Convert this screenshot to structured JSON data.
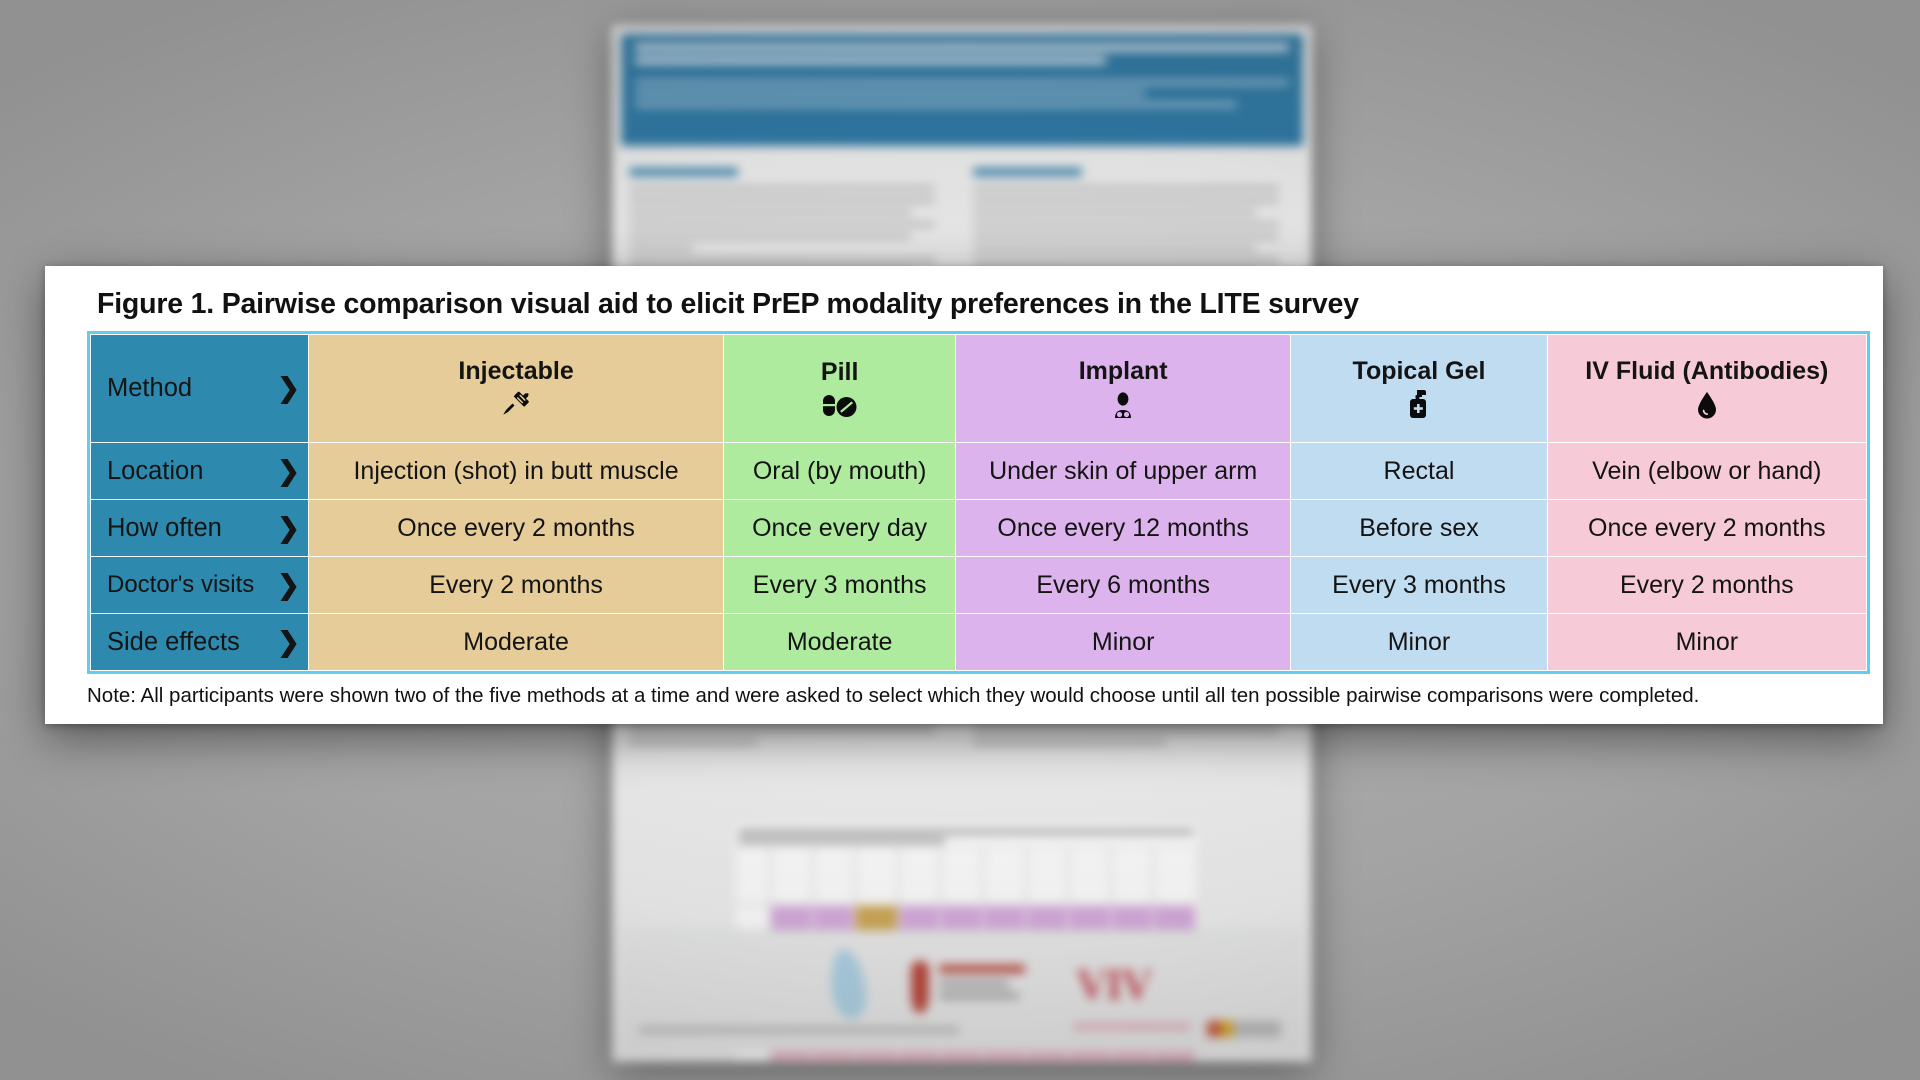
{
  "figure": {
    "title": "Figure 1. Pairwise comparison visual aid to elicit PrEP modality preferences in the LITE survey",
    "note": "Note: All participants were shown two of the five methods at a time and were asked to select which they would choose until all ten possible pairwise comparisons were completed."
  },
  "colors": {
    "label_column": "#2d89ae",
    "table_frame": "#63cdf0",
    "injectable": "#e5cc99",
    "pill": "#aeeb9e",
    "implant": "#dcb3ec",
    "topical_gel": "#bfdcf1",
    "iv_fluid": "#f7cad8",
    "card_background": "#ffffff",
    "page_background": "#a9a9a9"
  },
  "table": {
    "corner_label": "Method",
    "corner_chevron": "❯",
    "columns": [
      {
        "key": "injectable",
        "label": "Injectable",
        "icon": "syringe-icon"
      },
      {
        "key": "pill",
        "label": "Pill",
        "icon": "pills-icon"
      },
      {
        "key": "implant",
        "label": "Implant",
        "icon": "implant-arm-icon"
      },
      {
        "key": "topical_gel",
        "label": "Topical Gel",
        "icon": "gel-pump-bottle-icon"
      },
      {
        "key": "iv_fluid",
        "label": "IV Fluid (Antibodies)",
        "icon": "droplet-icon"
      }
    ],
    "rows": [
      {
        "label": "Location",
        "chevron": "❯",
        "cells": [
          "Injection (shot) in butt muscle",
          "Oral (by mouth)",
          "Under skin of upper arm",
          "Rectal",
          "Vein (elbow or hand)"
        ]
      },
      {
        "label": "How often",
        "chevron": "❯",
        "cells": [
          "Once every 2 months",
          "Once every day",
          "Once every 12 months",
          "Before sex",
          "Once every 2 months"
        ]
      },
      {
        "label": "Doctor's visits",
        "chevron": "❯",
        "cells": [
          "Every 2 months",
          "Every 3 months",
          "Every 6 months",
          "Every 3 months",
          "Every 2 months"
        ]
      },
      {
        "label": "Side effects",
        "chevron": "❯",
        "cells": [
          "Moderate",
          "Moderate",
          "Minor",
          "Minor",
          "Minor"
        ]
      }
    ]
  },
  "background_poster": {
    "description": "blurred scientific conference poster behind the figure overlay",
    "logo_text": "VIV"
  }
}
